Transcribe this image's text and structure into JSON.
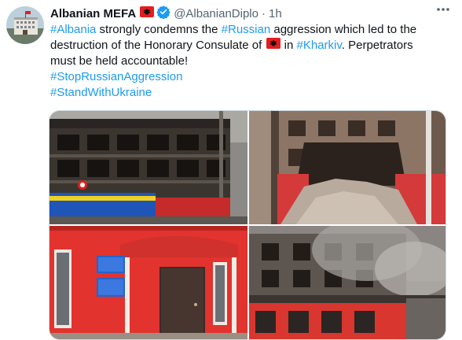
{
  "tweet": {
    "author_name": "Albanian MEFA",
    "handle": "@AlbanianDiplo",
    "separator": "·",
    "time": "1h",
    "line1": {
      "h1": "#Albania",
      "t1": " strongly condemns the ",
      "h2": "#Russian",
      "t2": " aggression which led to the"
    },
    "line2": {
      "t1": "destruction of the Honorary Consulate of ",
      "t2": " in ",
      "h1": "#Kharkiv",
      "t3": ". Perpetrators"
    },
    "line3": "must be held accountable!",
    "hashtag_1": "#StopRussianAggression",
    "hashtag_2": "#StandWithUkraine"
  },
  "media": {
    "count": 4,
    "photos": [
      {
        "subject": "burned-building-facade"
      },
      {
        "subject": "collapsed-building-rubble"
      },
      {
        "subject": "consulate-red-entrance"
      },
      {
        "subject": "smoking-building"
      }
    ]
  },
  "colors": {
    "link": "#1d9bf0",
    "text": "#0f1419",
    "secondary": "#536471",
    "verified": "#1d9bf0",
    "flag_red": "#e41e20"
  },
  "icons": {
    "flag": "albania-flag-icon",
    "verified": "verified-badge-icon",
    "more": "more-options-icon"
  }
}
